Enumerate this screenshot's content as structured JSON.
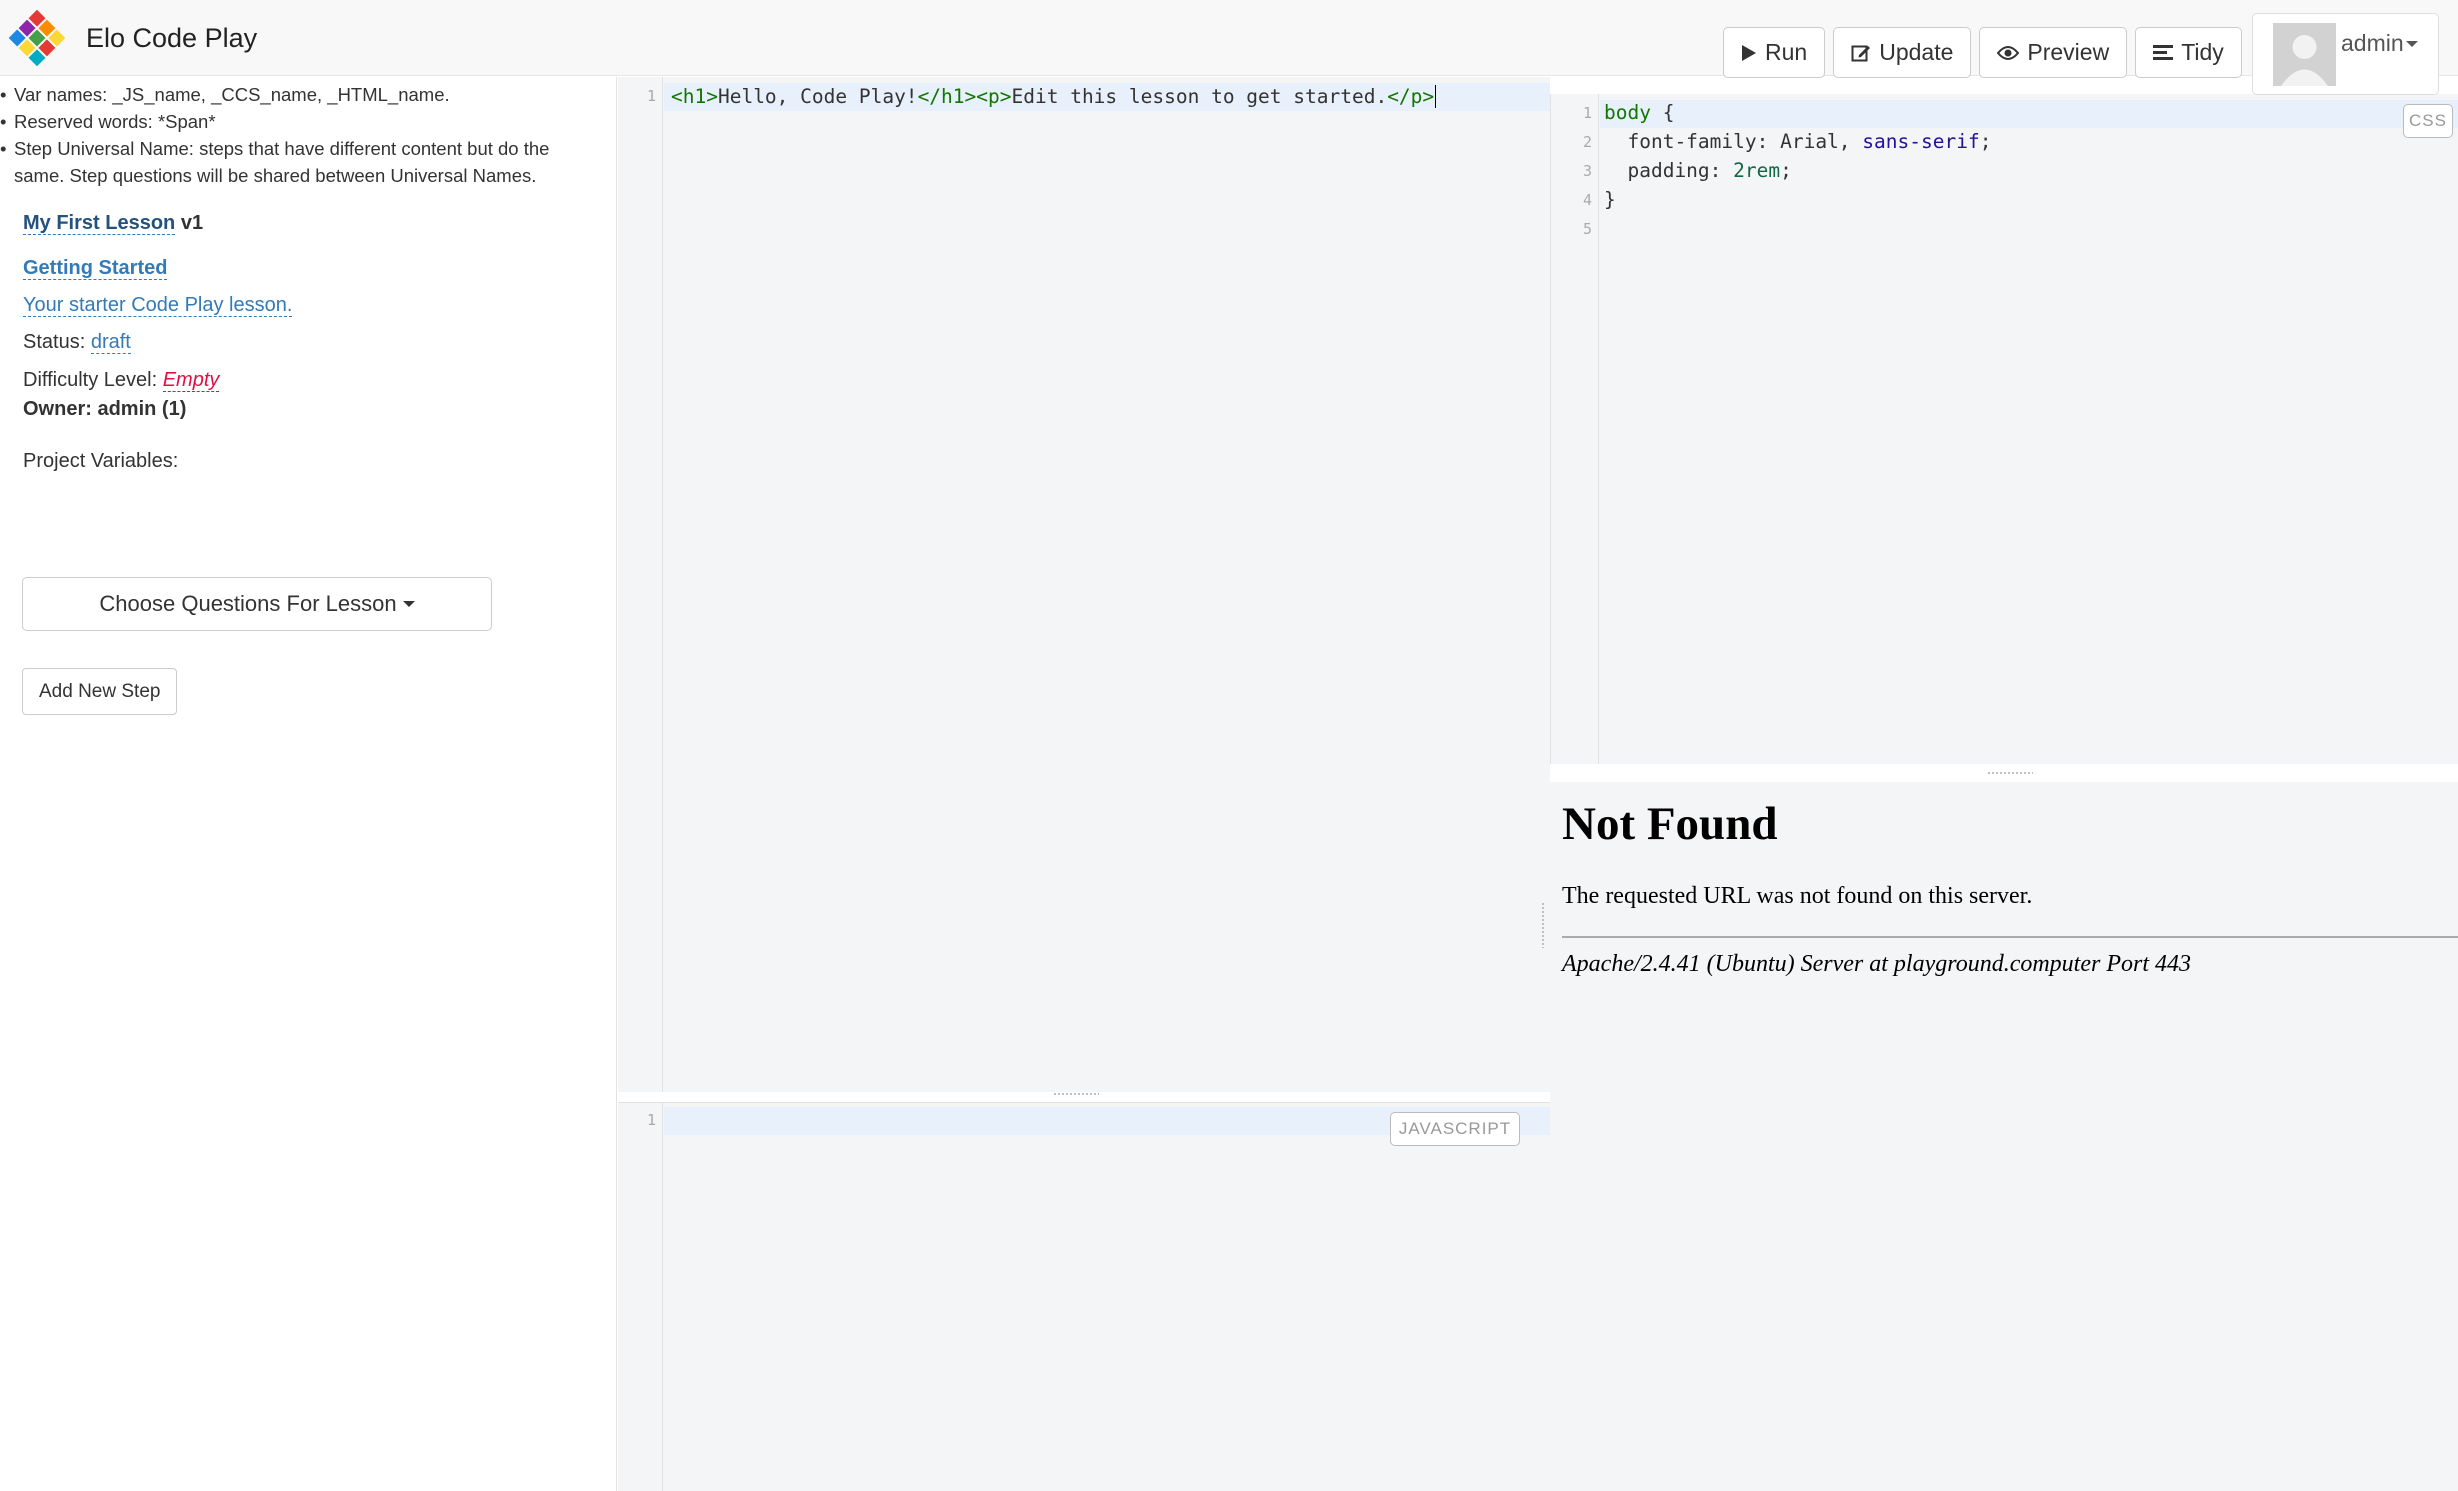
{
  "app": {
    "title": "Elo Code Play"
  },
  "toolbar": {
    "run": "Run",
    "update": "Update",
    "preview": "Preview",
    "tidy": "Tidy",
    "user": "admin"
  },
  "sidebar": {
    "notes": [
      "Var names: _JS_name, _CCS_name, _HTML_name.",
      "Reserved words: *Span*",
      "Step Universal Name: steps that have different content but do the same. Step questions will be shared between Universal Names."
    ],
    "lesson_title": "My First Lesson",
    "lesson_version": "v1",
    "step_title": "Getting Started",
    "step_description": "Your starter Code Play lesson.",
    "status_label": "Status:",
    "status_value": "draft",
    "difficulty_label": "Difficulty Level:",
    "difficulty_value": "Empty",
    "owner": "Owner: admin (1)",
    "project_variables_label": "Project Variables:",
    "choose_questions": "Choose Questions For Lesson",
    "add_step": "Add New Step"
  },
  "html_editor": {
    "line_numbers": [
      "1"
    ],
    "line1": {
      "t1": "<h1>",
      "t2": "Hello, Code Play!",
      "t3": "</h1>",
      "t4": "<p>",
      "t5": "Edit this lesson to get started.",
      "t6": "</p>"
    }
  },
  "css_editor": {
    "mode": "CSS",
    "line_numbers": [
      "1",
      "2",
      "3",
      "4",
      "5"
    ],
    "l1_selector": "body",
    "l1_brace": " {",
    "l2_prop": "  font-family: Arial, ",
    "l2_val": "sans-serif",
    "l2_end": ";",
    "l3_prop": "  padding: ",
    "l3_val": "2rem",
    "l3_end": ";",
    "l4": "}"
  },
  "js_editor": {
    "mode": "JAVASCRIPT",
    "line_numbers": [
      "1"
    ]
  },
  "preview": {
    "title": "Not Found",
    "message": "The requested URL was not found on this server.",
    "address": "Apache/2.4.41 (Ubuntu) Server at playground.computer Port 443"
  }
}
